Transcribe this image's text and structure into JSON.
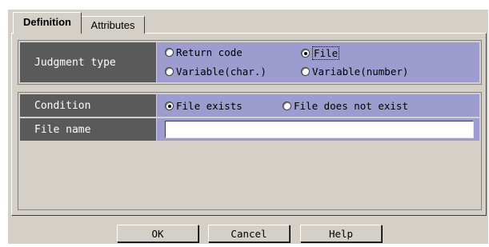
{
  "tabs": [
    {
      "label": "Definition",
      "active": true
    },
    {
      "label": "Attributes",
      "active": false
    }
  ],
  "judgment": {
    "label": "Judgment type",
    "options": [
      {
        "label": "Return code",
        "selected": false
      },
      {
        "label": "File",
        "selected": true
      },
      {
        "label": "Variable(char.)",
        "selected": false
      },
      {
        "label": "Variable(number)",
        "selected": false
      }
    ]
  },
  "condition": {
    "label": "Condition",
    "options": [
      {
        "label": "File exists",
        "selected": true
      },
      {
        "label": "File does not exist",
        "selected": false
      }
    ]
  },
  "filename": {
    "label": "File name",
    "value": ""
  },
  "buttons": {
    "ok": "OK",
    "cancel": "Cancel",
    "help": "Help"
  },
  "colors": {
    "label_bg": "#5a5a5a",
    "field_bg": "#9c9ccf",
    "dialog_bg": "#d4d0c8"
  }
}
